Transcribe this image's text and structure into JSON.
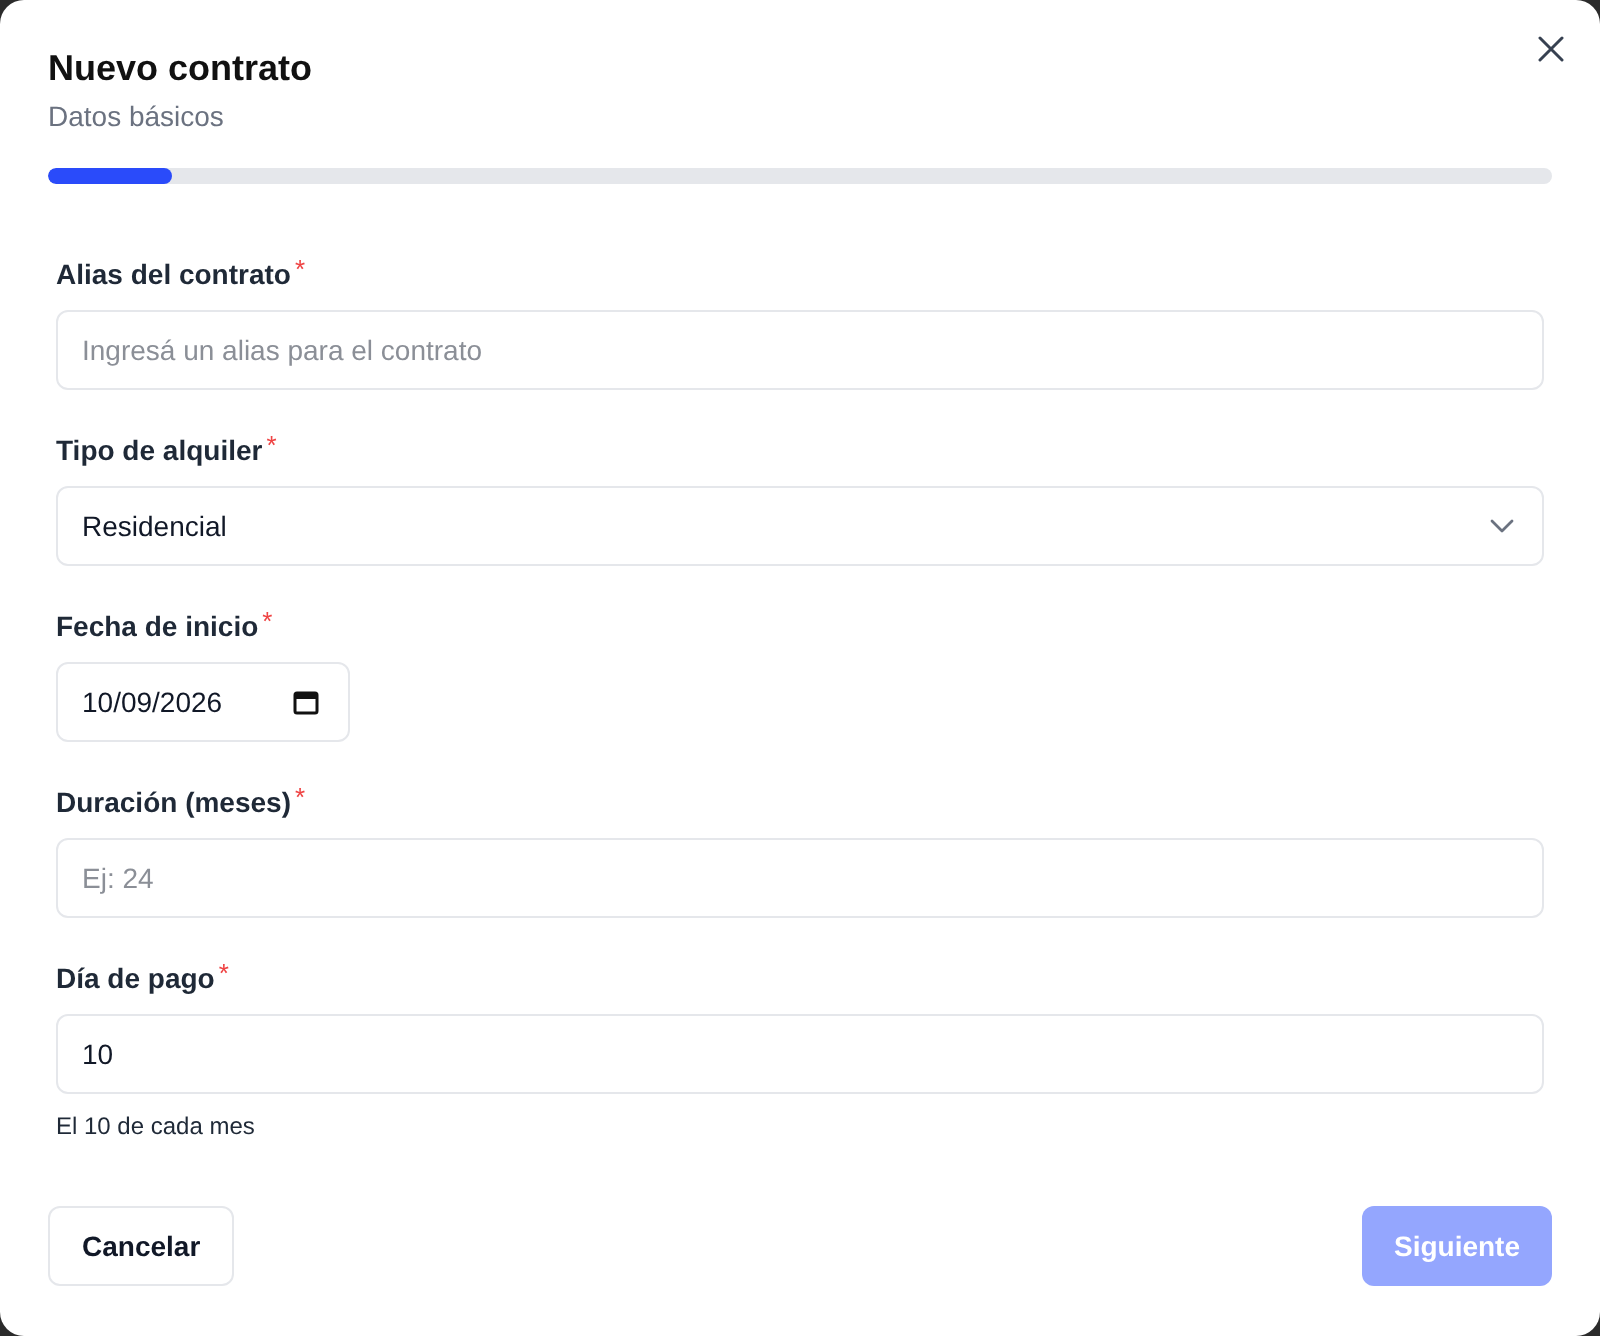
{
  "dialog": {
    "title": "Nuevo contrato",
    "subtitle": "Datos básicos"
  },
  "progress": {
    "level": 0.083
  },
  "fields": [
    {
      "kind": "text",
      "label": "Alias del contrato",
      "required_mark": "*",
      "placeholder": "Ingresá un alias para el contrato"
    },
    {
      "kind": "select",
      "label": "Tipo de alquiler",
      "required_mark": "*",
      "value": "Residencial"
    },
    {
      "kind": "date",
      "label": "Fecha de inicio",
      "required_mark": "*",
      "value": "10/09/2026"
    },
    {
      "kind": "text",
      "label": "Duración (meses)",
      "required_mark": "*",
      "placeholder": "Ej: 24"
    },
    {
      "kind": "text",
      "label": "Día de pago",
      "required_mark": "*",
      "value": "10",
      "hint": "El 10 de cada mes"
    }
  ],
  "buttons": [
    {
      "label": "Cancelar",
      "kind": "secondary",
      "disabled": false
    },
    {
      "label": "Siguiente",
      "kind": "primary",
      "disabled": true
    }
  ]
}
